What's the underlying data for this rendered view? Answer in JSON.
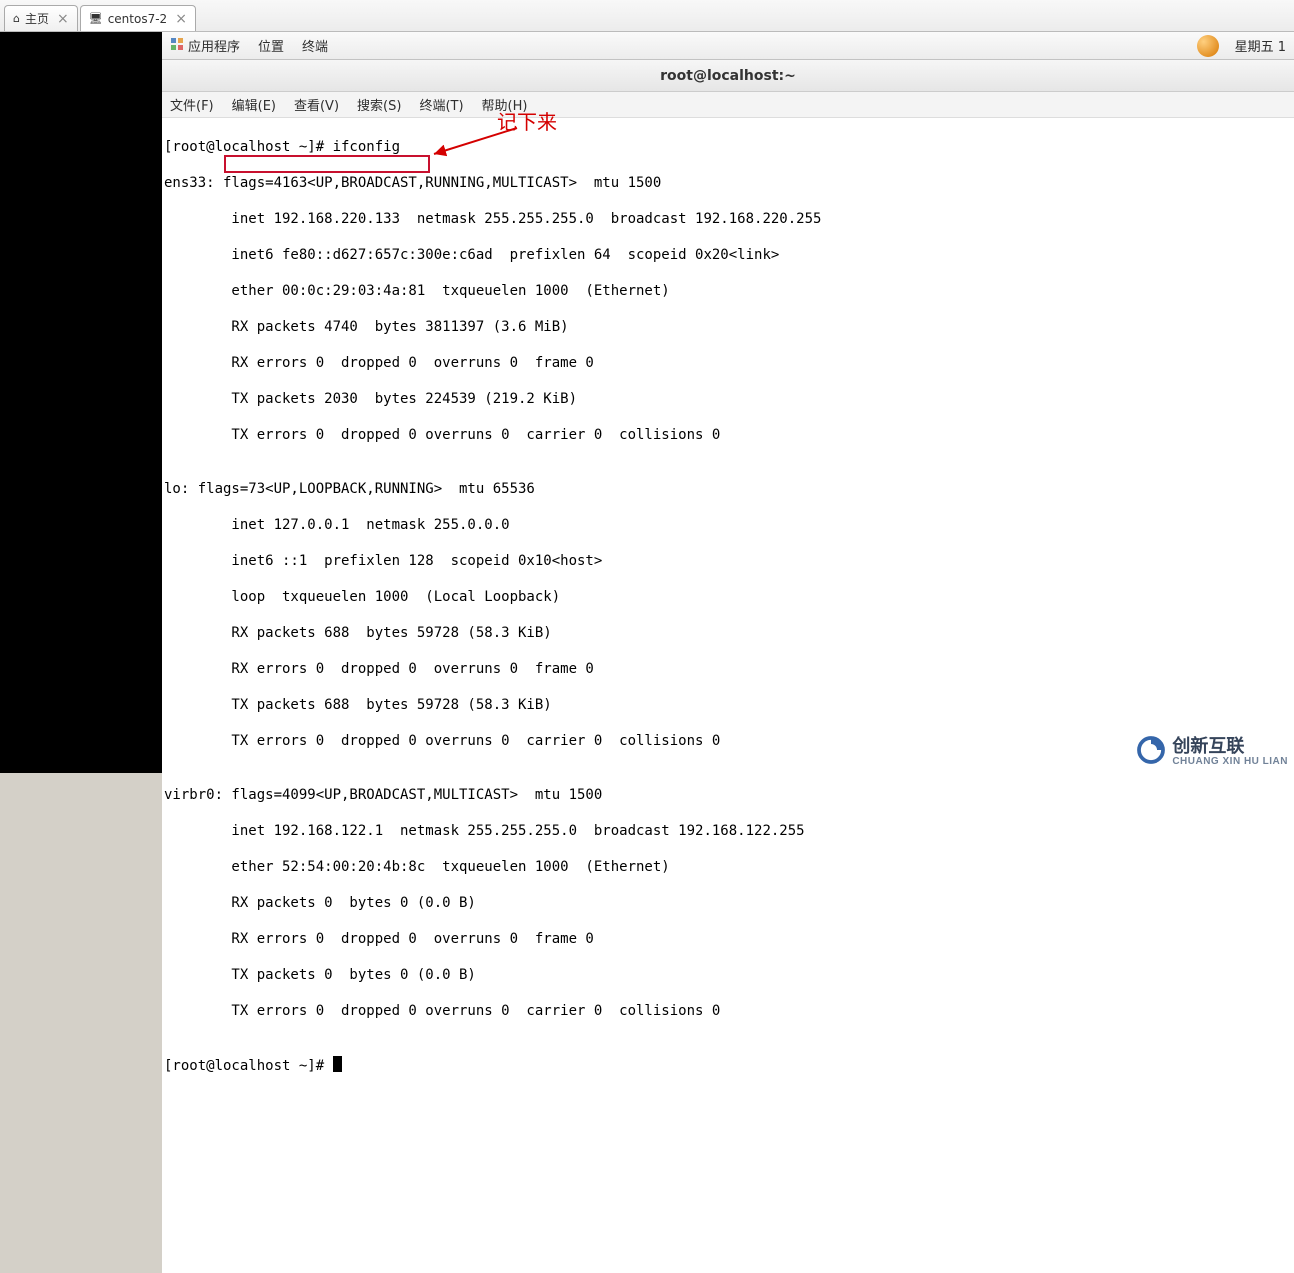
{
  "vm_tabs": {
    "home": {
      "label": "主页"
    },
    "vm1": {
      "label": "centos7-2"
    }
  },
  "gnome": {
    "applications": "应用程序",
    "places": "位置",
    "terminal": "终端",
    "clock": "星期五 1"
  },
  "terminal": {
    "title": "root@localhost:~",
    "menu": {
      "file": "文件(F)",
      "edit": "编辑(E)",
      "view": "查看(V)",
      "search": "搜索(S)",
      "term": "终端(T)",
      "help": "帮助(H)"
    },
    "lines": {
      "l0": "[root@localhost ~]# ifconfig",
      "l1": "ens33: flags=4163<UP,BROADCAST,RUNNING,MULTICAST>  mtu 1500",
      "l2": "        inet 192.168.220.133  netmask 255.255.255.0  broadcast 192.168.220.255",
      "l3": "        inet6 fe80::d627:657c:300e:c6ad  prefixlen 64  scopeid 0x20<link>",
      "l4": "        ether 00:0c:29:03:4a:81  txqueuelen 1000  (Ethernet)",
      "l5": "        RX packets 4740  bytes 3811397 (3.6 MiB)",
      "l6": "        RX errors 0  dropped 0  overruns 0  frame 0",
      "l7": "        TX packets 2030  bytes 224539 (219.2 KiB)",
      "l8": "        TX errors 0  dropped 0 overruns 0  carrier 0  collisions 0",
      "l9": "",
      "l10": "lo: flags=73<UP,LOOPBACK,RUNNING>  mtu 65536",
      "l11": "        inet 127.0.0.1  netmask 255.0.0.0",
      "l12": "        inet6 ::1  prefixlen 128  scopeid 0x10<host>",
      "l13": "        loop  txqueuelen 1000  (Local Loopback)",
      "l14": "        RX packets 688  bytes 59728 (58.3 KiB)",
      "l15": "        RX errors 0  dropped 0  overruns 0  frame 0",
      "l16": "        TX packets 688  bytes 59728 (58.3 KiB)",
      "l17": "        TX errors 0  dropped 0 overruns 0  carrier 0  collisions 0",
      "l18": "",
      "l19": "virbr0: flags=4099<UP,BROADCAST,MULTICAST>  mtu 1500",
      "l20": "        inet 192.168.122.1  netmask 255.255.255.0  broadcast 192.168.122.255",
      "l21": "        ether 52:54:00:20:4b:8c  txqueuelen 1000  (Ethernet)",
      "l22": "        RX packets 0  bytes 0 (0.0 B)",
      "l23": "        RX errors 0  dropped 0  overruns 0  frame 0",
      "l24": "        TX packets 0  bytes 0 (0.0 B)",
      "l25": "        TX errors 0  dropped 0 overruns 0  carrier 0  collisions 0",
      "l26": "",
      "l27": "[root@localhost ~]# "
    }
  },
  "annotation": {
    "note": "记下来"
  },
  "highlight": {
    "color": "#c8102e",
    "target_text": "inet 192.168.220.133"
  },
  "watermark": {
    "text": "创新互联",
    "sub": "CHUANG XIN HU LIAN"
  }
}
